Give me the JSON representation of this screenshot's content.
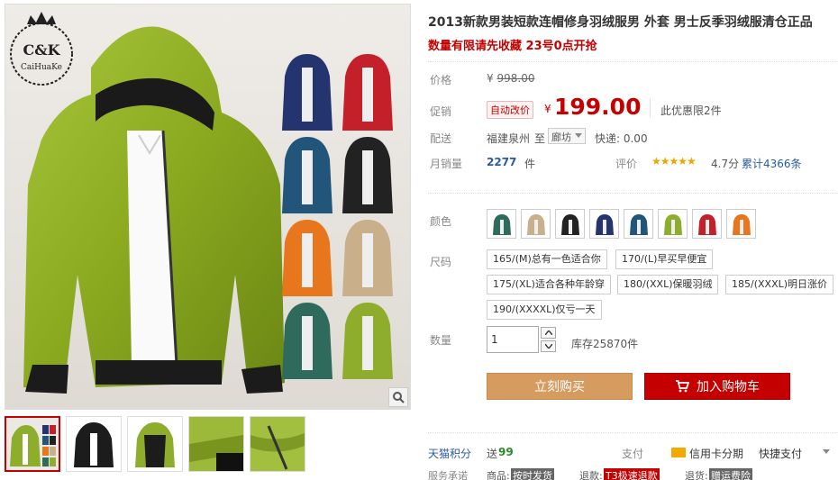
{
  "gallery": {
    "logo_initials": "C&K",
    "logo_name": "CaiHuaKe",
    "zoom_icon": "magnifier-icon",
    "thumbnail_count": 5
  },
  "product": {
    "title": "2013新款男装短款连帽修身羽绒服男 外套 男士反季羽绒服清仓正品",
    "promo": "数量有限请先收藏 23号0点开抢"
  },
  "price": {
    "label": "价格",
    "currency": "¥",
    "original": "998.00"
  },
  "promotion": {
    "label": "促销",
    "badge": "自动改价",
    "currency": "¥",
    "price": "199.00",
    "note": "此优惠限2件"
  },
  "shipping": {
    "label": "配送",
    "from": "福建泉州",
    "to_word": "至",
    "destination": "廊坊",
    "fee": "快递: 0.00"
  },
  "sales": {
    "label": "月销量",
    "count": "2277",
    "unit": "件",
    "review_label": "评价",
    "stars": "★★★★★",
    "score": "4.7分",
    "cumulative": "累计4366条"
  },
  "color": {
    "label": "颜色",
    "swatches": [
      "#2f6b5c",
      "#c9b08a",
      "#222222",
      "#23346e",
      "#22557a",
      "#8fad2c",
      "#c4202a",
      "#e8761d"
    ]
  },
  "size": {
    "label": "尺码",
    "options": [
      "165/(M)总有一色适合你",
      "170/(L)早买早便宜",
      "175/(XL)适合各种年龄穿",
      "180/(XXL)保暖羽绒",
      "185/(XXXL)明日涨价",
      "190/(XXXXL)仅亏一天"
    ]
  },
  "quantity": {
    "label": "数量",
    "value": "1",
    "stock": "库存25870件"
  },
  "actions": {
    "buy_label": "立刻购买",
    "cart_label": "加入购物车"
  },
  "footer": {
    "points_label": "天猫积分",
    "points_prefix": "送",
    "points_value": "99",
    "pay_label": "支付",
    "credit_label": "信用卡分期",
    "quickpay_label": "快捷支付",
    "service_label": "服务承诺",
    "goods_label": "商品:",
    "goods_tag": "按时发货",
    "refund_label": "退款:",
    "refund_tag": "T3极速退款",
    "return_label": "退货:",
    "return_tag": "赠运费险"
  },
  "colors": {
    "accent_red": "#c40000",
    "buy_orange": "#d59b5f",
    "link_blue": "#2b5aa3",
    "star_gold": "#e8a800"
  }
}
